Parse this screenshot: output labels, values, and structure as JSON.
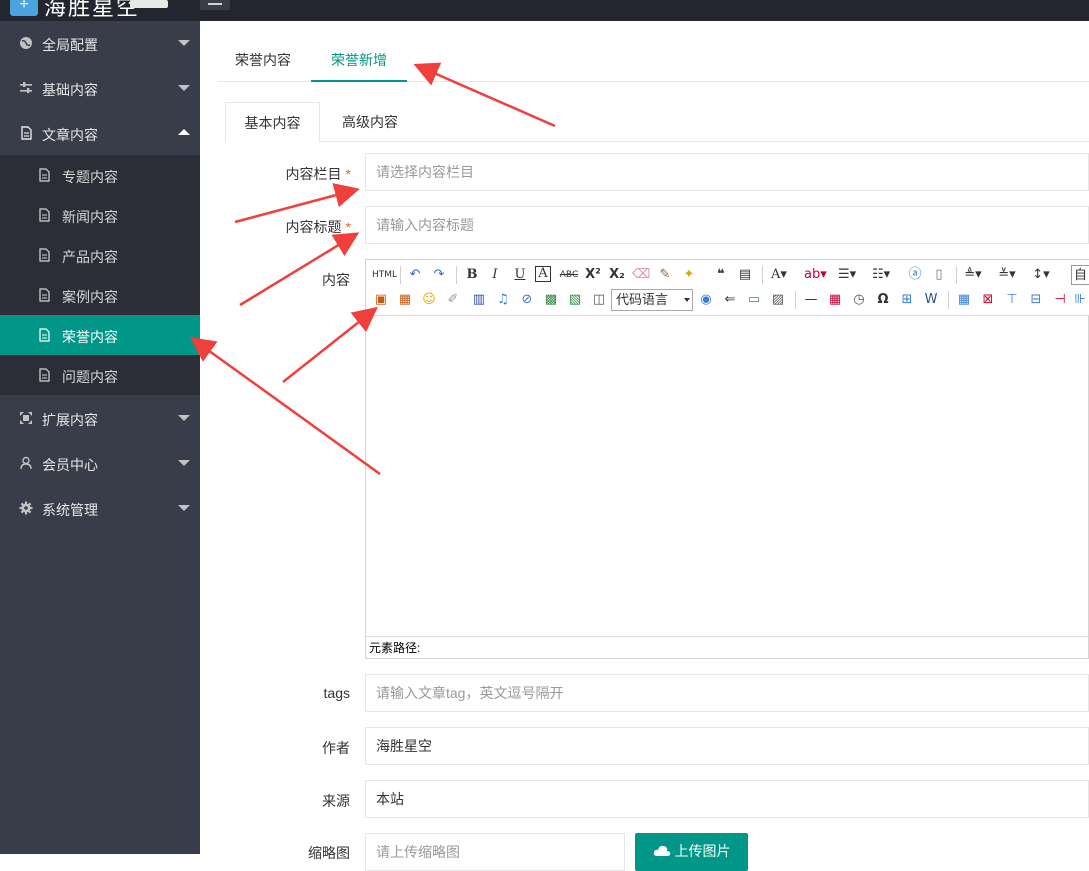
{
  "header": {
    "logo_text": "海胜星空",
    "logo_icon": "logo-icon"
  },
  "sidebar": {
    "items": [
      {
        "label": "全局配置",
        "icon": "globe-icon"
      },
      {
        "label": "基础内容",
        "icon": "sliders-icon"
      },
      {
        "label": "文章内容",
        "icon": "document-icon"
      },
      {
        "label": "扩展内容",
        "icon": "expand-icon"
      },
      {
        "label": "会员中心",
        "icon": "user-icon"
      },
      {
        "label": "系统管理",
        "icon": "gear-icon"
      }
    ],
    "sub_items": [
      {
        "label": "专题内容"
      },
      {
        "label": "新闻内容"
      },
      {
        "label": "产品内容"
      },
      {
        "label": "案例内容"
      },
      {
        "label": "荣誉内容",
        "active": true
      },
      {
        "label": "问题内容"
      }
    ],
    "active_color": "#009688"
  },
  "tabs": {
    "top": [
      "荣誉内容",
      "荣誉新增"
    ],
    "active_top": "荣誉新增",
    "card": [
      "基本内容",
      "高级内容"
    ],
    "active_card": "基本内容"
  },
  "form": {
    "category": {
      "label": "内容栏目",
      "required": "*",
      "placeholder": "请选择内容栏目"
    },
    "title": {
      "label": "内容标题",
      "required": "*",
      "placeholder": "请输入内容标题"
    },
    "content": {
      "label": "内容"
    },
    "tags": {
      "label": "tags",
      "placeholder": "请输入文章tag，英文逗号隔开"
    },
    "author": {
      "label": "作者",
      "value": "海胜星空"
    },
    "source": {
      "label": "来源",
      "value": "本站"
    },
    "thumbnail": {
      "label": "缩略图",
      "placeholder": "请上传缩略图",
      "button": "上传图片"
    }
  },
  "editor": {
    "code_language": "代码语言",
    "element_path": "元素路径:",
    "font_box": "自"
  },
  "annotation_color": "#f0403c"
}
